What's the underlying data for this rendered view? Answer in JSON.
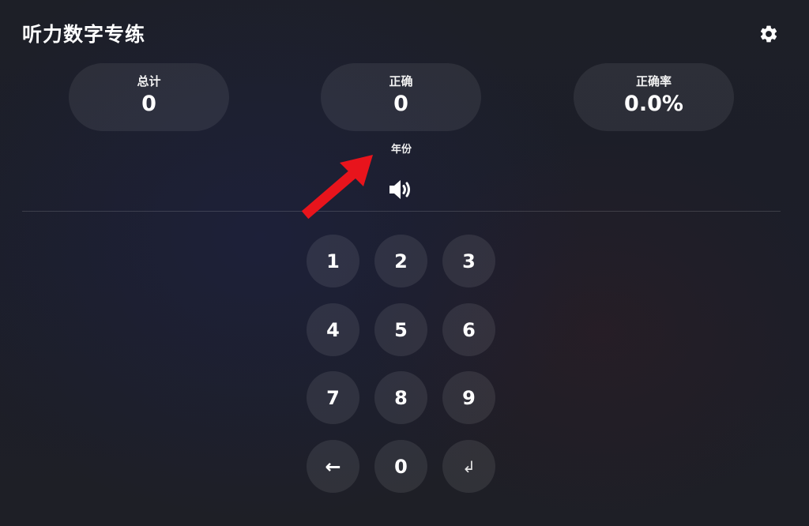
{
  "header": {
    "title": "听力数字专练",
    "settings_icon": "gear-icon"
  },
  "stats": [
    {
      "label": "总计",
      "value": "0"
    },
    {
      "label": "正确",
      "value": "0"
    },
    {
      "label": "正确率",
      "value": "0.0%"
    }
  ],
  "mode": {
    "label": "年份",
    "speaker_icon": "speaker-icon"
  },
  "annotation": {
    "color": "#e8141c"
  },
  "keypad": {
    "keys": [
      "1",
      "2",
      "3",
      "4",
      "5",
      "6",
      "7",
      "8",
      "9",
      "←",
      "0",
      "↲"
    ]
  },
  "colors": {
    "text": "#ffffff",
    "background": "#1f2026",
    "annotation_arrow": "#e8141c"
  }
}
